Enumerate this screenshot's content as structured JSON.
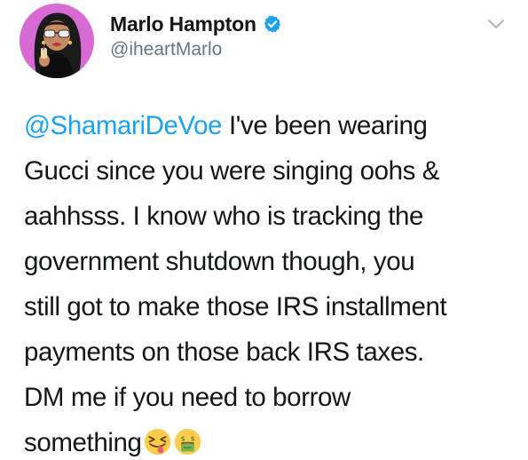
{
  "tweet": {
    "author": {
      "display_name": "Marlo Hampton",
      "handle": "@iheartMarlo",
      "verified": true,
      "avatar_icon": "profile-avatar-cartoon",
      "verified_icon": "verified-badge-icon"
    },
    "menu_icon": "chevron-down-icon",
    "body": {
      "mention": "@ShamariDeVoe",
      "line1_rest": " I've been wearing",
      "line2": "Gucci since you were singing oohs &",
      "line3": "aahhsss. I know who is tracking the",
      "line4": "government shutdown though, you",
      "line5": "still got to make those IRS installment",
      "line6": "payments on those back IRS taxes.",
      "line7": "DM me if you need to borrow",
      "line8": "something",
      "emojis": [
        "zany-tongue-face-emoji",
        "money-mouth-face-emoji"
      ]
    }
  },
  "colors": {
    "link": "#1da1f2",
    "text": "#14171a",
    "secondary": "#657786",
    "verified": "#1da1f2",
    "avatar_bg": "#d86bd3"
  }
}
